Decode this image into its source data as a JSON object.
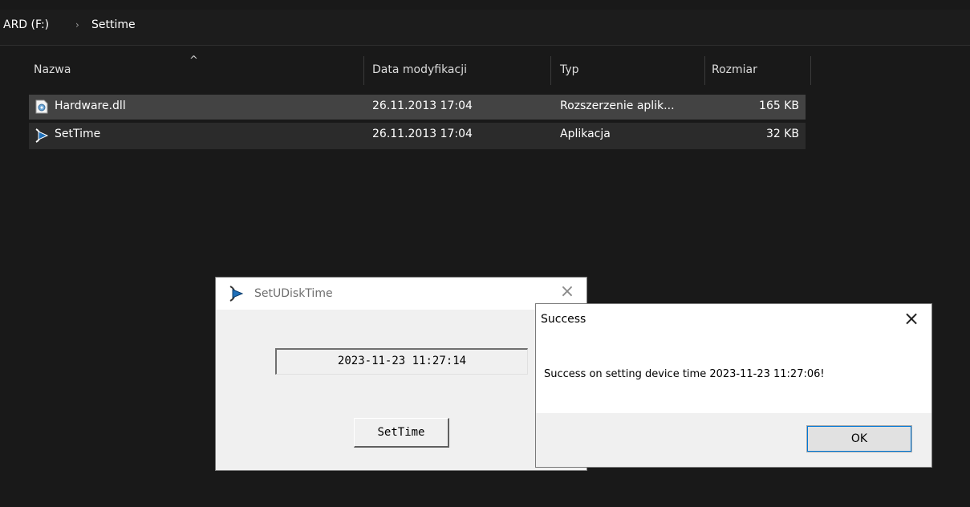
{
  "breadcrumb": {
    "drive": "ARD (F:)",
    "separator": "›",
    "folder": "Settime"
  },
  "columns": {
    "name": "Nazwa",
    "modified": "Data modyfikacji",
    "type": "Typ",
    "size": "Rozmiar",
    "sort_indicator": "^"
  },
  "files": [
    {
      "name": "Hardware.dll",
      "modified": "26.11.2013 17:04",
      "type": "Rozszerzenie aplik...",
      "size": "165 KB",
      "icon": "dll-file-icon"
    },
    {
      "name": "SetTime",
      "modified": "26.11.2013 17:04",
      "type": "Aplikacja",
      "size": "32 KB",
      "icon": "app-icon"
    }
  ],
  "settime_dialog": {
    "title": "SetUDiskTime",
    "close": "×",
    "time_value": "2023-11-23 11:27:14",
    "button": "SetTime"
  },
  "success_dialog": {
    "title": "Success",
    "close": "×",
    "message": "Success on setting device time 2023-11-23 11:27:06!",
    "ok": "OK"
  }
}
